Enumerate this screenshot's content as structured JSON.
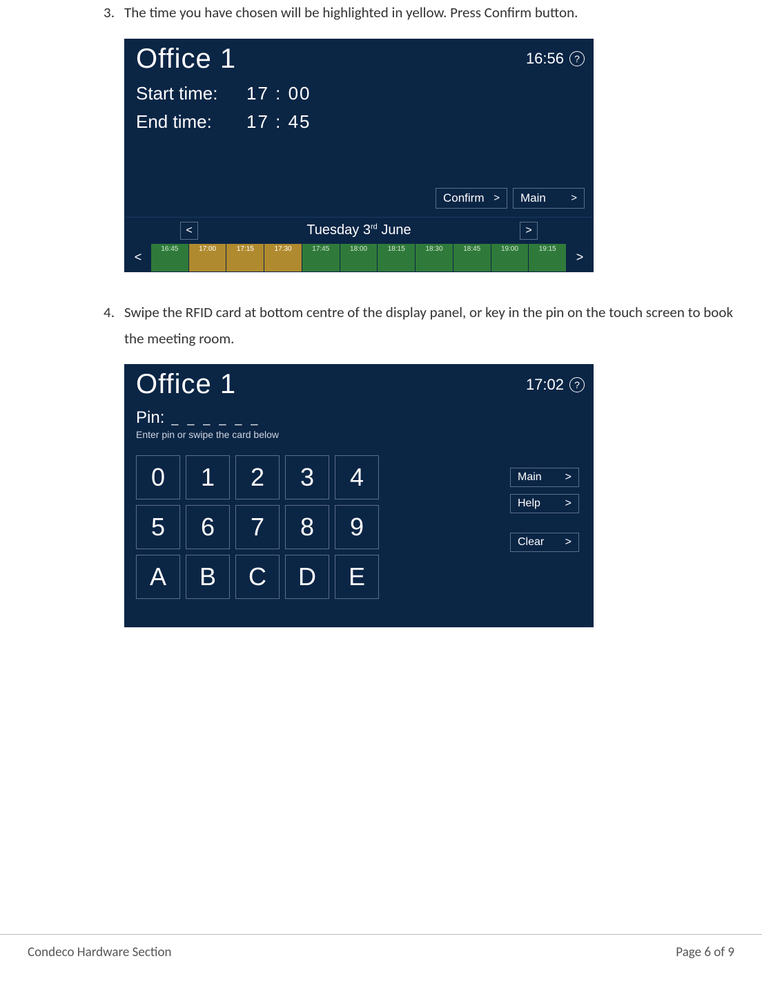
{
  "steps": {
    "s3": {
      "num": "3.",
      "text": "The time you have chosen will be highlighted in yellow.  Press Confirm button."
    },
    "s4": {
      "num": "4.",
      "text": "Swipe the RFID card at bottom centre of the display panel, or key in the pin on the touch screen to book the meeting room."
    }
  },
  "panel1": {
    "title": "Office 1",
    "clock": "16:56",
    "help": "?",
    "start_label": "Start time:",
    "start_value": "17 : 00",
    "end_label": "End time:",
    "end_value": "17 : 45",
    "confirm": "Confirm",
    "main": "Main",
    "date_prev": "<",
    "date_next": ">",
    "date_day": "Tuesday",
    "date_num": "3",
    "date_suffix": "rd",
    "date_month": "June",
    "tl_prev": "<",
    "tl_next": ">",
    "slots": [
      {
        "t": "16:45",
        "hl": false
      },
      {
        "t": "17:00",
        "hl": true
      },
      {
        "t": "17:15",
        "hl": true
      },
      {
        "t": "17:30",
        "hl": true
      },
      {
        "t": "17:45",
        "hl": false
      },
      {
        "t": "18:00",
        "hl": false
      },
      {
        "t": "18:15",
        "hl": false
      },
      {
        "t": "18:30",
        "hl": false
      },
      {
        "t": "18:45",
        "hl": false
      },
      {
        "t": "19:00",
        "hl": false
      },
      {
        "t": "19:15",
        "hl": false
      }
    ]
  },
  "panel2": {
    "title": "Office 1",
    "clock": "17:02",
    "help": "?",
    "pin_label": "Pin:",
    "pin_dashes": "_ _ _ _ _ _",
    "pin_hint": "Enter pin or swipe the card below",
    "keys": [
      "0",
      "1",
      "2",
      "3",
      "4",
      "5",
      "6",
      "7",
      "8",
      "9",
      "A",
      "B",
      "C",
      "D",
      "E"
    ],
    "main": "Main",
    "help_btn": "Help",
    "clear": "Clear"
  },
  "footer": {
    "left": "Condeco Hardware Section",
    "right": "Page 6 of 9"
  },
  "chevron_right": ">"
}
